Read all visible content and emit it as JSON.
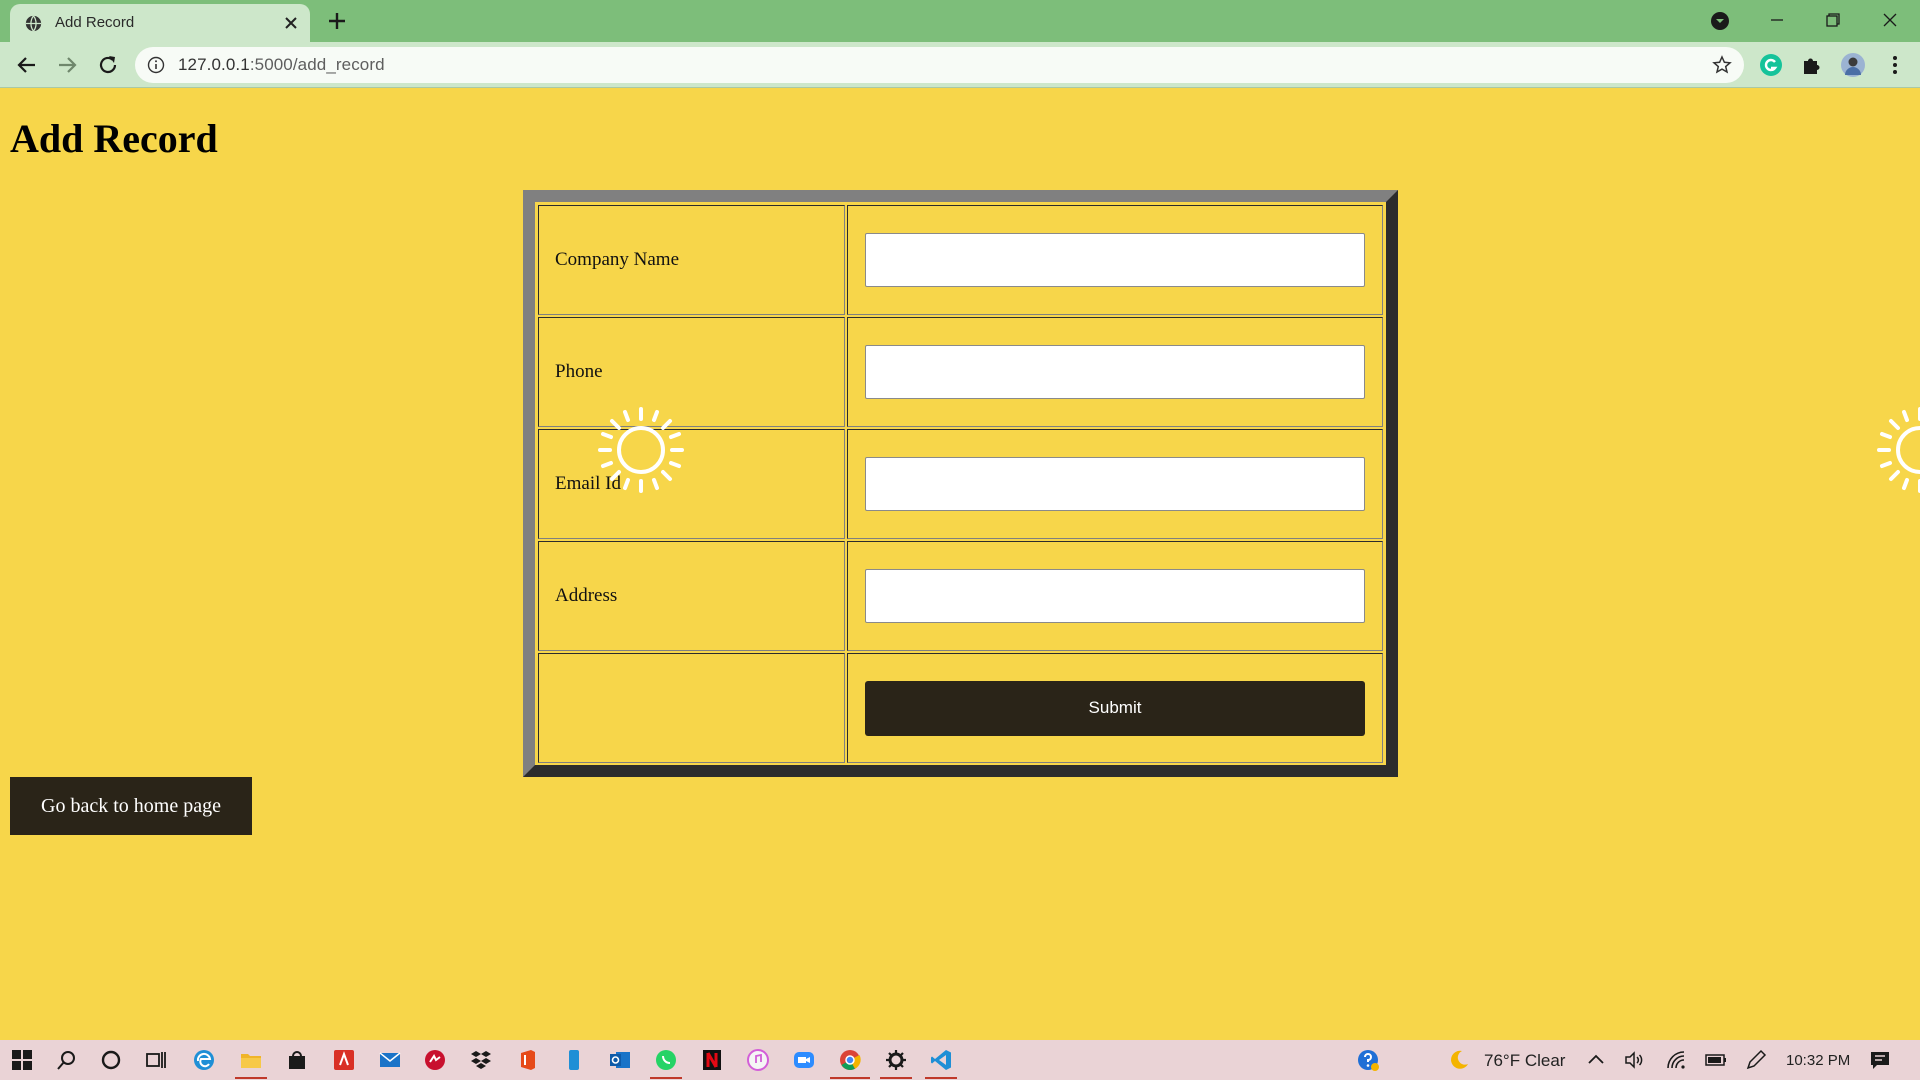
{
  "browser": {
    "tab_title": "Add Record",
    "url_host": "127.0.0.1",
    "url_path": ":5000/add_record"
  },
  "page": {
    "heading": "Add Record",
    "form": {
      "fields": [
        {
          "label": "Company Name",
          "value": ""
        },
        {
          "label": "Phone",
          "value": ""
        },
        {
          "label": "Email Id",
          "value": ""
        },
        {
          "label": "Address",
          "value": ""
        }
      ],
      "submit_label": "Submit"
    },
    "home_link_label": "Go back to home page"
  },
  "taskbar": {
    "weather": "76°F  Clear",
    "time": "10:32 PM"
  },
  "colors": {
    "page_background": "#f7d64a",
    "button_background": "#2a2418",
    "tab_strip": "#7dbe7a",
    "toolbar": "#cde7ca",
    "taskbar": "#ead3d6"
  }
}
